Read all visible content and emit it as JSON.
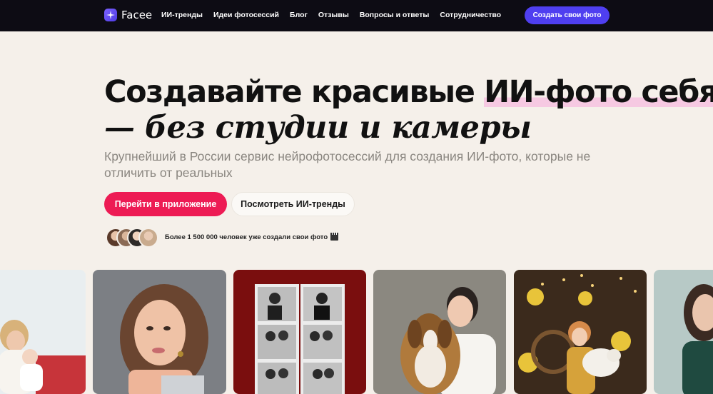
{
  "brand": {
    "name": "Facee",
    "icon": "sparkle-icon",
    "accent": "#4f3ff0"
  },
  "nav": {
    "links": [
      "ИИ-тренды",
      "Идеи фотосессий",
      "Блог",
      "Отзывы",
      "Вопросы и ответы",
      "Сотрудничество"
    ],
    "cta": "Создать свои фото"
  },
  "hero": {
    "title_plain": "Создавайте красивые ",
    "title_highlight": "ИИ-фото себя",
    "title_line2": "— без студии и камеры",
    "subtitle": "Крупнейший в России сервис нейрофотосессий для создания ИИ-фото, которые не отличить от реальных",
    "primary_button": "Перейти в приложение",
    "secondary_button": "Посмотреть ИИ-тренды",
    "social_proof": "Более 1 500 000 человек уже создали свои фото",
    "social_icon": "clapperboard-icon",
    "highlight_color": "#f6c9e2",
    "primary_color": "#ed1b54"
  },
  "gallery": {
    "items": [
      "mother-with-baby",
      "woman-portrait",
      "photobooth-strip",
      "woman-with-beagle",
      "girl-with-lamb-daffodils",
      "woman-in-green"
    ]
  }
}
